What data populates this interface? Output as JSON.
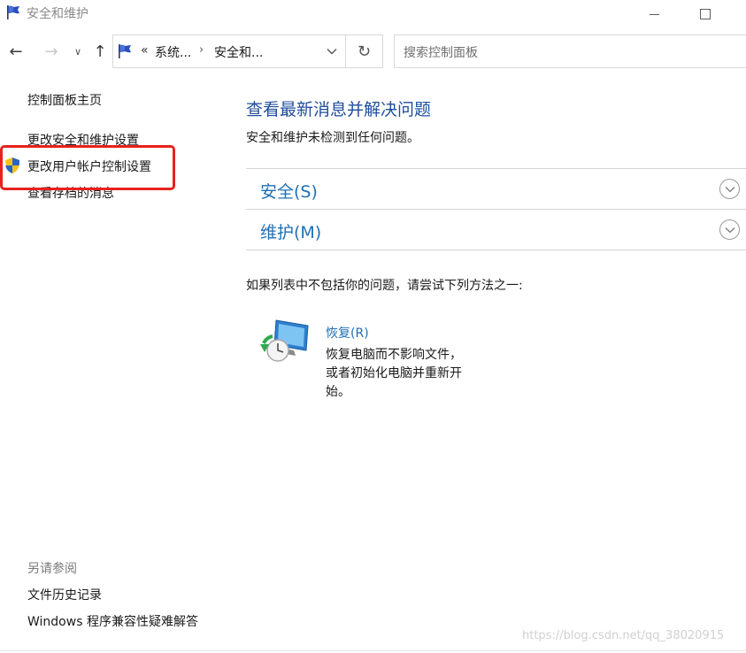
{
  "window": {
    "title": "安全和维护",
    "app_icon": "flag-icon",
    "controls": {
      "minimize": "minimize-icon",
      "maximize": "maximize-icon"
    }
  },
  "nav": {
    "back": "←",
    "forward": "→",
    "recent": "∨",
    "up": "↑",
    "refresh": "↻"
  },
  "address": {
    "overflow": "«",
    "segments": [
      "系统...",
      "安全和..."
    ],
    "separator": "›"
  },
  "search": {
    "placeholder": "搜索控制面板"
  },
  "sidebar": {
    "home": "控制面板主页",
    "links": [
      "更改安全和维护设置",
      "更改用户帐户控制设置",
      "查看存档的消息"
    ],
    "see_also_label": "另请参阅",
    "see_also_links": [
      "文件历史记录",
      "Windows 程序兼容性疑难解答"
    ]
  },
  "main": {
    "heading": "查看最新消息并解决问题",
    "status": "安全和维护未检测到任何问题。",
    "sections": [
      "安全(S)",
      "维护(M)"
    ],
    "help_text": "如果列表中不包括你的问题，请尝试下列方法之一:",
    "recovery": {
      "title": "恢复(R)",
      "description": "恢复电脑而不影响文件，或者初始化电脑并重新开始。"
    }
  },
  "watermark": "https://blog.csdn.net/qq_38020915",
  "colors": {
    "heading": "#1f4e9c",
    "link": "#1f6fb4",
    "highlight": "#e8211c"
  }
}
